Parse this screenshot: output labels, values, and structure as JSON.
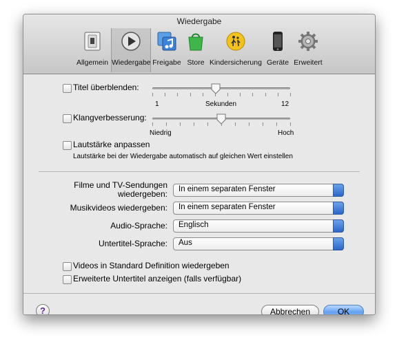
{
  "window": {
    "title": "Wiedergabe"
  },
  "toolbar": {
    "items": [
      {
        "label": "Allgemein",
        "icon": "switch-icon"
      },
      {
        "label": "Wiedergabe",
        "icon": "play-icon",
        "selected": true
      },
      {
        "label": "Freigabe",
        "icon": "music-share-icon"
      },
      {
        "label": "Store",
        "icon": "store-bag-icon"
      },
      {
        "label": "Kindersicherung",
        "icon": "parental-control-icon"
      },
      {
        "label": "Geräte",
        "icon": "device-icon"
      },
      {
        "label": "Erweitert",
        "icon": "gear-icon"
      }
    ]
  },
  "crossfade": {
    "label": "Titel überblenden:",
    "checked": false,
    "min_label": "1",
    "unit_label": "Sekunden",
    "max_label": "12",
    "value_fraction": 0.46
  },
  "sound_enhancer": {
    "label": "Klangverbesserung:",
    "checked": false,
    "low_label": "Niedrig",
    "high_label": "Hoch",
    "value_fraction": 0.5
  },
  "sound_check": {
    "label": "Lautstärke anpassen",
    "checked": false,
    "description": "Lautstärke bei der Wiedergabe automatisch auf gleichen Wert einstellen"
  },
  "movies": {
    "label_line1": "Filme und TV-Sendungen",
    "label_line2": "wiedergeben:",
    "value": "In einem separaten Fenster"
  },
  "music_videos": {
    "label": "Musikvideos wiedergeben:",
    "value": "In einem separaten Fenster"
  },
  "audio_language": {
    "label": "Audio-Sprache:",
    "value": "Englisch"
  },
  "subtitle_language": {
    "label": "Untertitel-Sprache:",
    "value": "Aus"
  },
  "sd_videos": {
    "label": "Videos in Standard Definition wiedergeben",
    "checked": false
  },
  "closed_captions": {
    "label": "Erweiterte Untertitel anzeigen (falls verfügbar)",
    "checked": false
  },
  "buttons": {
    "cancel": "Abbrechen",
    "ok": "OK",
    "help": "?"
  }
}
